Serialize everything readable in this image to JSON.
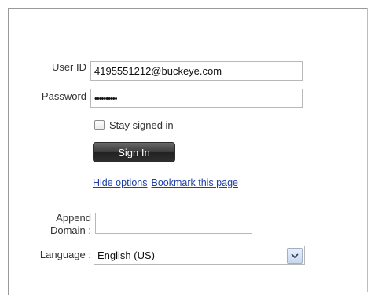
{
  "login": {
    "user_id_label": "User ID",
    "user_id_value": "4195551212@buckeye.com",
    "password_label": "Password",
    "password_value": "••••••••••",
    "stay_signed_in_label": "Stay signed in",
    "sign_in_label": "Sign In",
    "hide_options_label": "Hide options",
    "bookmark_label": "Bookmark this page"
  },
  "options": {
    "append_label_line1": "Append",
    "append_label_line2": "Domain :",
    "append_value": "",
    "language_label": "Language :",
    "language_value": "English (US)"
  },
  "icons": {
    "chevron": "chevron-down-icon"
  }
}
